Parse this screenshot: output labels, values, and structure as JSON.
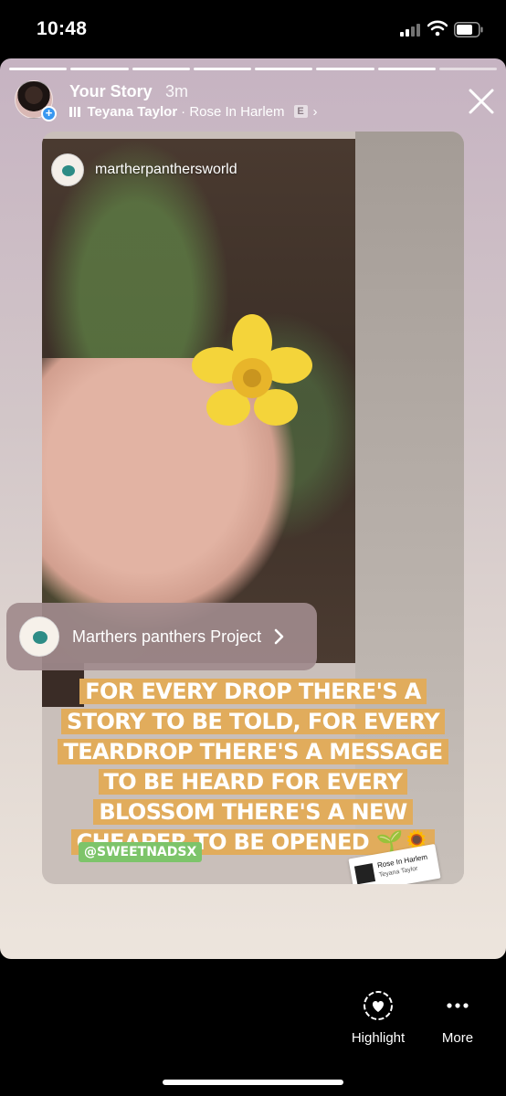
{
  "status_bar": {
    "time": "10:48"
  },
  "story": {
    "title": "Your Story",
    "time_ago": "3m",
    "music": {
      "artist": "Teyana Taylor",
      "song": "· Rose In Harlem",
      "explicit": "E"
    }
  },
  "media": {
    "account_handle": "martherpanthersworld",
    "caption": "FOR EVERY DROP THERE'S A STORY TO BE TOLD, FOR EVERY TEARDROP THERE'S A MESSAGE TO BE HEARD FOR EVERY BLOSSOM THERE'S A NEW CHEAPER TO BE OPENED 🌱🌻",
    "mention": "@SWEETNADSX",
    "music_sticker": {
      "title": "Rose In Harlem",
      "artist": "Teyana Taylor"
    }
  },
  "link_sticker": {
    "label": "Marthers panthers Project"
  },
  "bottom_bar": {
    "highlight_label": "Highlight",
    "more_label": "More"
  },
  "colors": {
    "caption_bg": "#e1ac5c",
    "mention_bg": "#7dc46a",
    "accent": "#3897f0"
  }
}
